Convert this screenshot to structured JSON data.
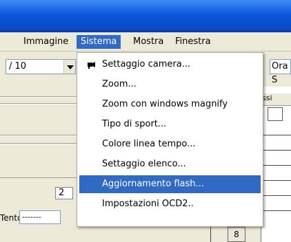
{
  "menubar": {
    "items": [
      {
        "label": "Immagine"
      },
      {
        "label": "Sistema"
      },
      {
        "label": "Mostra"
      },
      {
        "label": "Finestra"
      }
    ],
    "active_index": 1
  },
  "toolbar": {
    "combo_value": "/ 10",
    "number_value": "2",
    "entc_label": "Tentc",
    "entc_value": "-------",
    "ora_label": "Ora S"
  },
  "grid": {
    "header": "ssi",
    "cell_value": "8"
  },
  "sistema_menu": {
    "items": [
      {
        "label": "Settaggio camera...",
        "icon": "camera-icon"
      },
      {
        "label": "Zoom..."
      },
      {
        "label": "Zoom con windows magnify"
      },
      {
        "label": "Tipo di sport..."
      },
      {
        "label": "Colore linea tempo..."
      },
      {
        "label": "Settaggio elenco..."
      },
      {
        "label": "Aggiornamento flash..."
      },
      {
        "label": "Impostazioni OCD2.."
      }
    ],
    "highlighted_index": 6
  },
  "colors": {
    "titlebar": "#0a52d6",
    "highlight": "#316ac5",
    "face": "#ece9d8"
  }
}
